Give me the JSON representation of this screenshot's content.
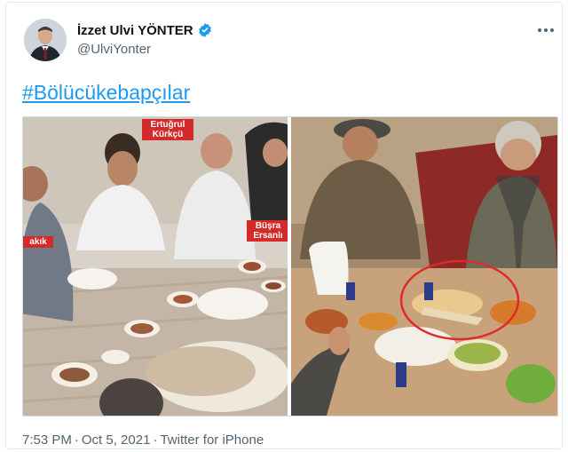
{
  "author": {
    "display_name": "İzzet Ulvi YÖNTER",
    "handle": "@UlviYonter",
    "verified": true,
    "avatar": "avatar-photo"
  },
  "tweet": {
    "hashtag": "#Bölücükebapçılar"
  },
  "media": {
    "left_photo": {
      "tags": {
        "top": "Ertuğrul\nKürkçü",
        "right": "Büşra\nErsanlı",
        "left": "akık"
      }
    },
    "right_photo": {}
  },
  "footer": {
    "time": "7:53 PM",
    "date": "Oct 5, 2021",
    "source": "Twitter for iPhone"
  },
  "colors": {
    "link": "#1d9bf0",
    "verified": "#1d9bf0",
    "secondary_text": "#536471",
    "tag_red": "#d42a2a"
  },
  "icons": [
    "verified-badge-icon",
    "more-options-icon"
  ]
}
